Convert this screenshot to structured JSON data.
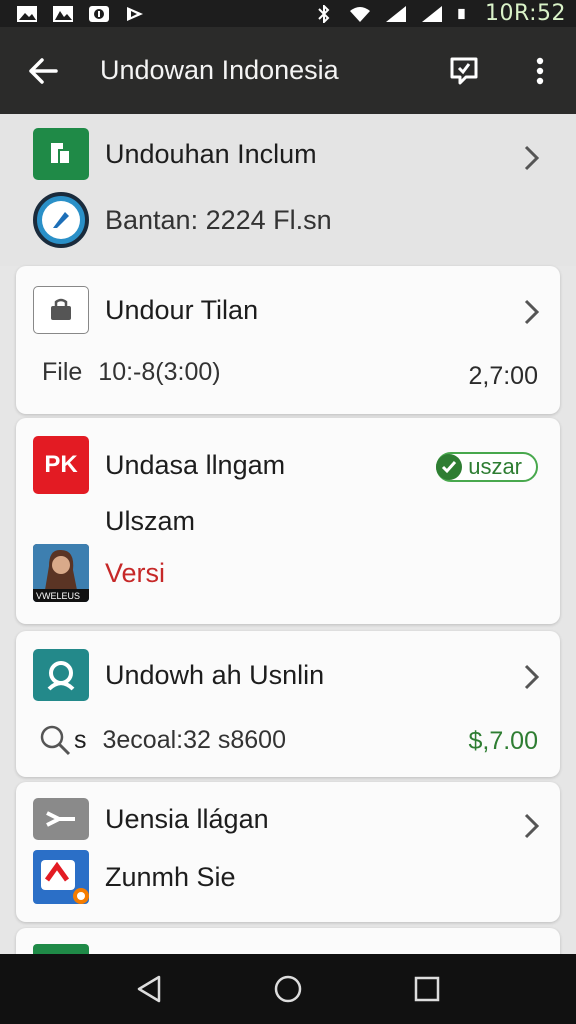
{
  "status_bar": {
    "time": "10R:52"
  },
  "app_bar": {
    "title": "Undowan Indonesia"
  },
  "header": {
    "row1_label": "Undouhan Inclum",
    "row2_label": "Bantan: 2224 Fl.sn"
  },
  "cards": [
    {
      "title": "Undour Tilan",
      "file_label": "File",
      "file_value": "10:-8(3:00)",
      "amount": "2,7:00"
    },
    {
      "title": "Undasa llngam",
      "badge": "uszar",
      "sub": "Ulszam",
      "icon_text": "PK",
      "thumb_caption": "VWELEUS",
      "version_label": "Versi"
    },
    {
      "title": "Undowh ah Usnlin",
      "search_text": "s",
      "value_text": "3ecoal:32 s8600",
      "amount": "$,7.00"
    },
    {
      "title": "Uensia llágan",
      "sub": "Zunmh Sie"
    }
  ],
  "colors": {
    "green": "#2e7d32",
    "red_icon": "#e31b23",
    "teal": "#23898a"
  }
}
